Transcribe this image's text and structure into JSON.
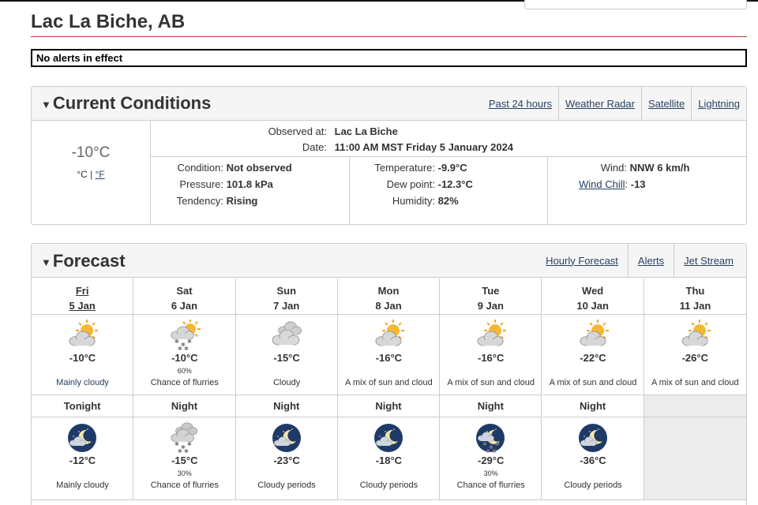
{
  "header": {
    "city": "Lac La Biche, AB",
    "alert": "No alerts in effect"
  },
  "current": {
    "title": "Current Conditions",
    "links": [
      "Past 24 hours",
      "Weather Radar",
      "Satellite",
      "Lightning"
    ],
    "big_temp": "-10°C",
    "unit_c": "°C",
    "unit_sep": " | ",
    "unit_f": "°F",
    "observed_at_label": "Observed at:",
    "observed_at": "Lac La Biche",
    "date_label": "Date:",
    "date": "11:00 AM MST Friday 5 January 2024",
    "condition_label": "Condition:",
    "condition": "Not observed",
    "pressure_label": "Pressure:",
    "pressure": "101.8 kPa",
    "tendency_label": "Tendency:",
    "tendency": "Rising",
    "temperature_label": "Temperature:",
    "temperature": "-9.9°C",
    "dewpoint_label": "Dew point:",
    "dewpoint": "-12.3°C",
    "humidity_label": "Humidity:",
    "humidity": "82%",
    "wind_label": "Wind:",
    "wind": "NNW 6 km/h",
    "windchill_label": "Wind Chill",
    "windchill": "-13"
  },
  "forecast": {
    "title": "Forecast",
    "links": [
      "Hourly Forecast",
      "Alerts",
      "Jet Stream"
    ],
    "days": [
      {
        "day": "Fri",
        "date": "5 Jan",
        "icon": "sun-cloud-icon",
        "temp": "-10°C",
        "pop": "",
        "summary": "Mainly cloudy",
        "today": true
      },
      {
        "day": "Sat",
        "date": "6 Jan",
        "icon": "sun-cloud-snow-icon",
        "temp": "-10°C",
        "pop": "60%",
        "summary": "Chance of flurries"
      },
      {
        "day": "Sun",
        "date": "7 Jan",
        "icon": "cloud-icon",
        "temp": "-15°C",
        "pop": "",
        "summary": "Cloudy"
      },
      {
        "day": "Mon",
        "date": "8 Jan",
        "icon": "sun-cloud-icon",
        "temp": "-16°C",
        "pop": "",
        "summary": "A mix of sun and cloud"
      },
      {
        "day": "Tue",
        "date": "9 Jan",
        "icon": "sun-cloud-icon",
        "temp": "-16°C",
        "pop": "",
        "summary": "A mix of sun and cloud"
      },
      {
        "day": "Wed",
        "date": "10 Jan",
        "icon": "sun-cloud-icon",
        "temp": "-22°C",
        "pop": "",
        "summary": "A mix of sun and cloud"
      },
      {
        "day": "Thu",
        "date": "11 Jan",
        "icon": "sun-cloud-icon",
        "temp": "-26°C",
        "pop": "",
        "summary": "A mix of sun and cloud"
      }
    ],
    "nights": [
      {
        "label": "Tonight",
        "icon": "moon-cloud-icon",
        "temp": "-12°C",
        "pop": "",
        "summary": "Mainly cloudy"
      },
      {
        "label": "Night",
        "icon": "cloud-snow-icon",
        "temp": "-15°C",
        "pop": "30%",
        "summary": "Chance of flurries"
      },
      {
        "label": "Night",
        "icon": "moon-cloud-icon",
        "temp": "-23°C",
        "pop": "",
        "summary": "Cloudy periods"
      },
      {
        "label": "Night",
        "icon": "moon-cloud-icon",
        "temp": "-18°C",
        "pop": "",
        "summary": "Cloudy periods"
      },
      {
        "label": "Night",
        "icon": "moon-cloud-snow-icon",
        "temp": "-29°C",
        "pop": "30%",
        "summary": "Chance of flurries"
      },
      {
        "label": "Night",
        "icon": "moon-cloud-icon",
        "temp": "-36°C",
        "pop": "",
        "summary": "Cloudy periods"
      }
    ]
  }
}
